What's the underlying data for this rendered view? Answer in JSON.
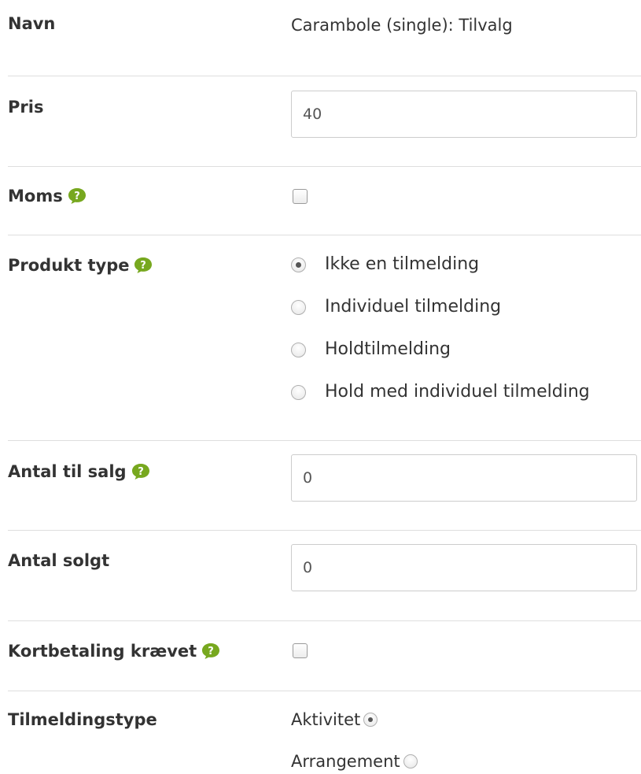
{
  "fields": {
    "name": {
      "label": "Navn",
      "value": "Carambole (single): Tilvalg"
    },
    "price": {
      "label": "Pris",
      "value": "40"
    },
    "vat": {
      "label": "Moms",
      "checked": false
    },
    "product_type": {
      "label": "Produkt type",
      "options": [
        {
          "label": "Ikke en tilmelding",
          "selected": true
        },
        {
          "label": "Individuel tilmelding",
          "selected": false
        },
        {
          "label": "Holdtilmelding",
          "selected": false
        },
        {
          "label": "Hold med individuel tilmelding",
          "selected": false
        }
      ]
    },
    "quantity_for_sale": {
      "label": "Antal til salg",
      "value": "0"
    },
    "quantity_sold": {
      "label": "Antal solgt",
      "value": "0"
    },
    "card_payment_required": {
      "label": "Kortbetaling krævet",
      "checked": false
    },
    "registration_type": {
      "label": "Tilmeldingstype",
      "options": [
        {
          "label": "Aktivitet",
          "selected": true
        },
        {
          "label": "Arrangement",
          "selected": false
        }
      ]
    }
  },
  "colors": {
    "help_icon": "#77a81f",
    "divider": "#dedede",
    "text": "#333333"
  },
  "icons": {
    "help": "question-speech-bubble-icon"
  }
}
